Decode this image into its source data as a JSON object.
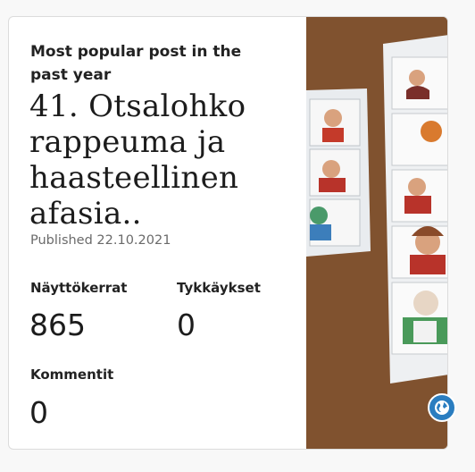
{
  "card": {
    "heading": "Most popular post in the past year",
    "post_title": "41. Otsalohko rappeuma ja haasteellinen afasia..",
    "published": "Published 22.10.2021",
    "stats": {
      "views_label": "Näyttökerrat",
      "views_value": "865",
      "likes_label": "Tykkäykset",
      "likes_value": "0",
      "comments_label": "Kommentit",
      "comments_value": "0"
    }
  },
  "icons": {
    "globe": "globe-icon"
  },
  "colors": {
    "globe_button": "#2a7dc0",
    "photo_background": "#8a5a34"
  }
}
